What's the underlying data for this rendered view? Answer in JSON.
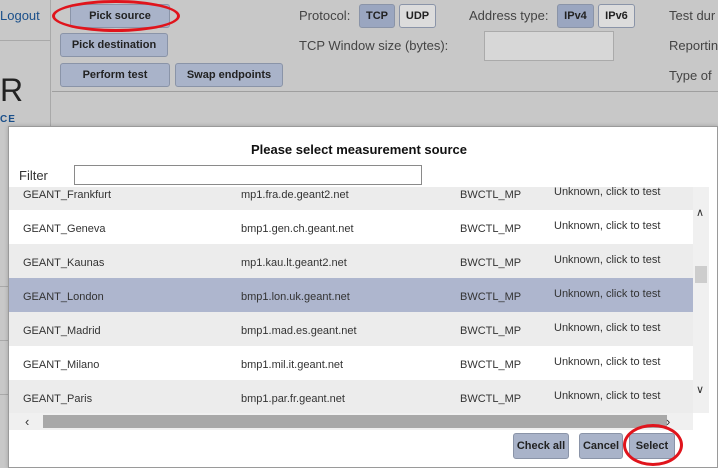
{
  "left": {
    "logout": "Logout",
    "logo_letter": "R",
    "logo_fragment": "CE"
  },
  "toolbar": {
    "pick_source": "Pick source",
    "pick_destination": "Pick destination",
    "perform_test": "Perform test",
    "swap_endpoints": "Swap endpoints",
    "protocol_label": "Protocol:",
    "tcp": "TCP",
    "udp": "UDP",
    "address_type_label": "Address type:",
    "ipv4": "IPv4",
    "ipv6": "IPv6",
    "test_dur_label": "Test dur",
    "tcp_window_label": "TCP Window size (bytes):",
    "tcp_window_value": "",
    "reporting_label": "Reportin",
    "type_label": "Type of"
  },
  "modal": {
    "title": "Please select measurement source",
    "filter_label": "Filter",
    "filter_value": "",
    "rows": [
      {
        "name": "GEANT_Frankfurt",
        "host": "mp1.fra.de.geant2.net",
        "type": "BWCTL_MP",
        "status": "Unknown, click to test"
      },
      {
        "name": "GEANT_Geneva",
        "host": "bmp1.gen.ch.geant.net",
        "type": "BWCTL_MP",
        "status": "Unknown, click to test"
      },
      {
        "name": "GEANT_Kaunas",
        "host": "mp1.kau.lt.geant2.net",
        "type": "BWCTL_MP",
        "status": "Unknown, click to test"
      },
      {
        "name": "GEANT_London",
        "host": "bmp1.lon.uk.geant.net",
        "type": "BWCTL_MP",
        "status": "Unknown, click to test"
      },
      {
        "name": "GEANT_Madrid",
        "host": "bmp1.mad.es.geant.net",
        "type": "BWCTL_MP",
        "status": "Unknown, click to test"
      },
      {
        "name": "GEANT_Milano",
        "host": "bmp1.mil.it.geant.net",
        "type": "BWCTL_MP",
        "status": "Unknown, click to test"
      },
      {
        "name": "GEANT_Paris",
        "host": "bmp1.par.fr.geant.net",
        "type": "BWCTL_MP",
        "status": "Unknown, click to test"
      }
    ],
    "selected_row": 3,
    "check_all": "Check all",
    "cancel": "Cancel",
    "select": "Select"
  },
  "icons": {
    "scroll_up": "chevron-up-icon",
    "scroll_down": "chevron-down-icon",
    "scroll_left": "chevron-left-icon",
    "scroll_right": "chevron-right-icon"
  },
  "colors": {
    "button": "#a9b3c9",
    "selected_row": "#aeb6ce",
    "highlight": "#e0141c",
    "link": "#1a4f8a"
  }
}
